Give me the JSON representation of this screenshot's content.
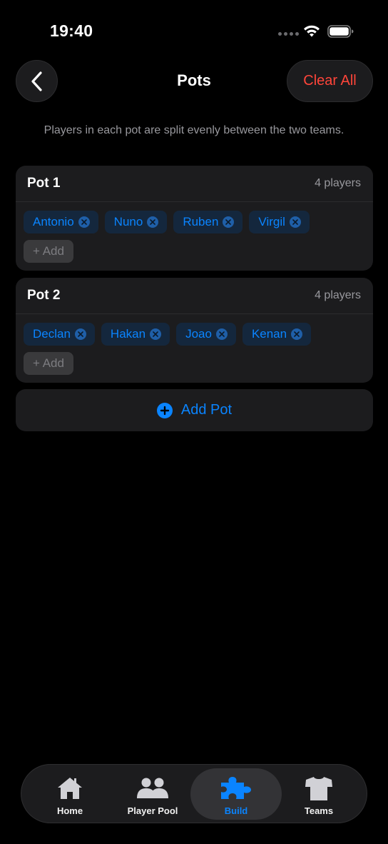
{
  "status_bar": {
    "time": "19:40"
  },
  "header": {
    "title": "Pots",
    "clear_all_label": "Clear All"
  },
  "subtitle": "Players in each pot are split evenly between the two teams.",
  "pots": [
    {
      "title": "Pot 1",
      "count": "4 players",
      "players": [
        "Antonio",
        "Nuno",
        "Ruben",
        "Virgil"
      ],
      "add_label": "+ Add"
    },
    {
      "title": "Pot 2",
      "count": "4 players",
      "players": [
        "Declan",
        "Hakan",
        "Joao",
        "Kenan"
      ],
      "add_label": "+ Add"
    }
  ],
  "add_pot_label": "Add Pot",
  "tabs": [
    {
      "label": "Home",
      "icon": "house-icon",
      "active": false
    },
    {
      "label": "Player Pool",
      "icon": "people-icon",
      "active": false
    },
    {
      "label": "Build",
      "icon": "puzzle-icon",
      "active": true
    },
    {
      "label": "Teams",
      "icon": "tshirt-icon",
      "active": false
    }
  ],
  "colors": {
    "accent": "#0a84ff",
    "destructive": "#ff453a",
    "card": "#1c1c1e",
    "background": "#000000"
  }
}
